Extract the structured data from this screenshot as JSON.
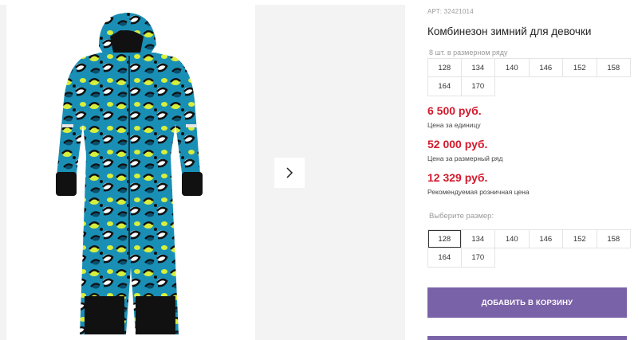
{
  "product": {
    "sku": "АРТ: 32421014",
    "title": "Комбинезон зимний для девочки",
    "row_label": "8 шт. в размерном ряду",
    "row_sizes": [
      "128",
      "134",
      "140",
      "146",
      "152",
      "158",
      "164",
      "170"
    ]
  },
  "prices": {
    "unit_price": "6 500 руб.",
    "unit_note": "Цена за единицу",
    "row_price": "52 000 руб.",
    "row_note": "Цена за размерный ряд",
    "retail_price": "12 329 руб.",
    "retail_note": "Рекомендуемая розничная цена"
  },
  "size_select": {
    "label": "Выберите размер:",
    "options": [
      "128",
      "134",
      "140",
      "146",
      "152",
      "158",
      "164",
      "170"
    ],
    "selected": "128"
  },
  "cart": {
    "add_label": "ДОБАВИТЬ В КОРЗИНУ"
  },
  "colors": {
    "accent": "#7a62a8",
    "price": "#d21a2d",
    "suit_base": "#1a8fb5",
    "suit_spots": "#c8e23a"
  }
}
